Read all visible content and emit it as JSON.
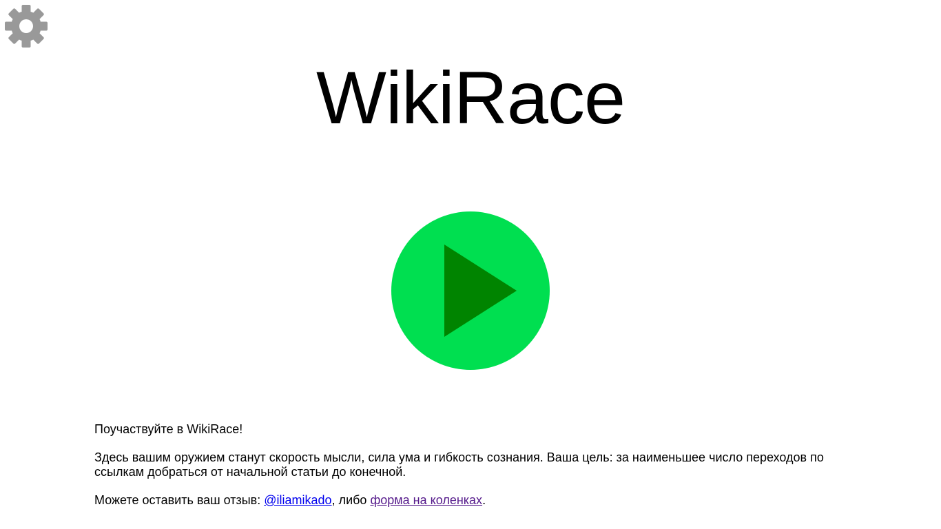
{
  "header": {
    "settings_icon": "gear-icon",
    "title": "WikiRace"
  },
  "play_button": {
    "icon": "play-icon",
    "circle_color": "#00df50",
    "triangle_color": "#008400"
  },
  "intro": {
    "heading": "Поучаствуйте в WikiRace!",
    "description": "Здесь вашим оружием станут скорость мысли, сила ума и гибкость сознания. Ваша цель: за наименьшее число переходов по ссылкам добраться от начальной статьи до конечной.",
    "feedback_prefix": "Можете оставить ваш отзыв: ",
    "feedback_link1": "@iliamikado",
    "feedback_middle": ", либо ",
    "feedback_link2": "форма на коленках",
    "feedback_suffix": "."
  },
  "colors": {
    "gear": "#999999",
    "link": "#0000ee",
    "visited_link": "#551a8b"
  }
}
